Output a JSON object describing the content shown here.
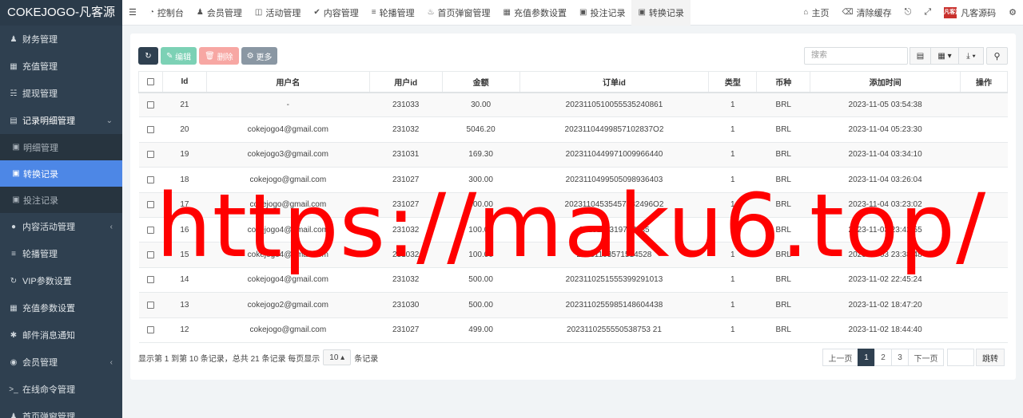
{
  "brand": "COKEJOGO-凡客源",
  "sidebar": {
    "items": [
      {
        "label": "财务管理",
        "icon": "users-icon"
      },
      {
        "label": "充值管理",
        "icon": "grid-icon"
      },
      {
        "label": "提现管理",
        "icon": "bank-icon"
      },
      {
        "label": "记录明细管理",
        "icon": "chart-icon"
      },
      {
        "label": "明细管理",
        "icon": "calendar-icon"
      },
      {
        "label": "转换记录",
        "icon": "calendar-icon"
      },
      {
        "label": "投注记录",
        "icon": "calendar-icon"
      },
      {
        "label": "内容活动管理",
        "icon": "circle-icon"
      },
      {
        "label": "轮播管理",
        "icon": "list-icon"
      },
      {
        "label": "VIP参数设置",
        "icon": "refresh-icon"
      },
      {
        "label": "充值参数设置",
        "icon": "grid-icon"
      },
      {
        "label": "邮件消息通知",
        "icon": "asterisk-icon"
      },
      {
        "label": "会员管理",
        "icon": "user-circle-icon"
      },
      {
        "label": "在线命令管理",
        "icon": "terminal-icon"
      },
      {
        "label": "首页弹窗管理",
        "icon": "user-icon"
      }
    ]
  },
  "topbar": {
    "tabs": [
      {
        "label": "控制台",
        "icon": "dashboard-icon"
      },
      {
        "label": "会员管理",
        "icon": "users-icon"
      },
      {
        "label": "活动管理",
        "icon": "folder-icon"
      },
      {
        "label": "内容管理",
        "icon": "check-circle-icon"
      },
      {
        "label": "轮播管理",
        "icon": "list-icon"
      },
      {
        "label": "首页弹窗管理",
        "icon": "bell-icon"
      },
      {
        "label": "充值参数设置",
        "icon": "grid-icon"
      },
      {
        "label": "投注记录",
        "icon": "calendar-icon"
      },
      {
        "label": "转换记录",
        "icon": "calendar-icon"
      }
    ],
    "home": "主页",
    "clear_cache": "清除缓存",
    "user_name": "凡客源码",
    "logo_text": "凡客源"
  },
  "toolbar": {
    "edit": "编辑",
    "delete": "删除",
    "more": "更多",
    "search_placeholder": "搜索"
  },
  "table": {
    "headers": [
      "Id",
      "用户名",
      "用户id",
      "金额",
      "订单id",
      "类型",
      "币种",
      "添加时间",
      "操作"
    ],
    "rows": [
      [
        "21",
        "-",
        "231033",
        "30.00",
        "2023110510055535240861",
        "1",
        "BRL",
        "2023-11-05 03:54:38"
      ],
      [
        "20",
        "cokejogo4@gmail.com",
        "231032",
        "5046.20",
        "20231104499857102837O2",
        "1",
        "BRL",
        "2023-11-04 05:23:30"
      ],
      [
        "19",
        "cokejogo3@gmail.com",
        "231031",
        "169.30",
        "2023110449971009966440",
        "1",
        "BRL",
        "2023-11-04 03:34:10"
      ],
      [
        "18",
        "cokejogo@gmail.com",
        "231027",
        "300.00",
        "2023110499505098936403",
        "1",
        "BRL",
        "2023-11-04 03:26:04"
      ],
      [
        "17",
        "cokejogo@gmail.com",
        "231027",
        "300.00",
        "20231104535457482496O2",
        "1",
        "BRL",
        "2023-11-04 03:23:02"
      ],
      [
        "16",
        "cokejogo4@gmail.com",
        "231032",
        "100.00",
        "2023110319797685",
        "1",
        "BRL",
        "2023-11-03 23:42:55"
      ],
      [
        "15",
        "cokejogo4@gmail.com",
        "231032",
        "100.00",
        "20231103571514528",
        "1",
        "BRL",
        "2023-11-03 23:38:48"
      ],
      [
        "14",
        "cokejogo4@gmail.com",
        "231032",
        "500.00",
        "2023110251555399291013",
        "1",
        "BRL",
        "2023-11-02 22:45:24"
      ],
      [
        "13",
        "cokejogo2@gmail.com",
        "231030",
        "500.00",
        "2023110255985148604438",
        "1",
        "BRL",
        "2023-11-02 18:47:20"
      ],
      [
        "12",
        "cokejogo@gmail.com",
        "231027",
        "499.00",
        "2023110255550538753 21",
        "1",
        "BRL",
        "2023-11-02 18:44:40"
      ]
    ]
  },
  "pager": {
    "info_prefix": "显示第 1 到第 10 条记录，总共 21 条记录 每页显示",
    "page_size": "10",
    "info_suffix": "条记录",
    "prev": "上一页",
    "pages": [
      "1",
      "2",
      "3"
    ],
    "next": "下一页",
    "jump": "跳转"
  },
  "watermark": "https://maku6.top/"
}
